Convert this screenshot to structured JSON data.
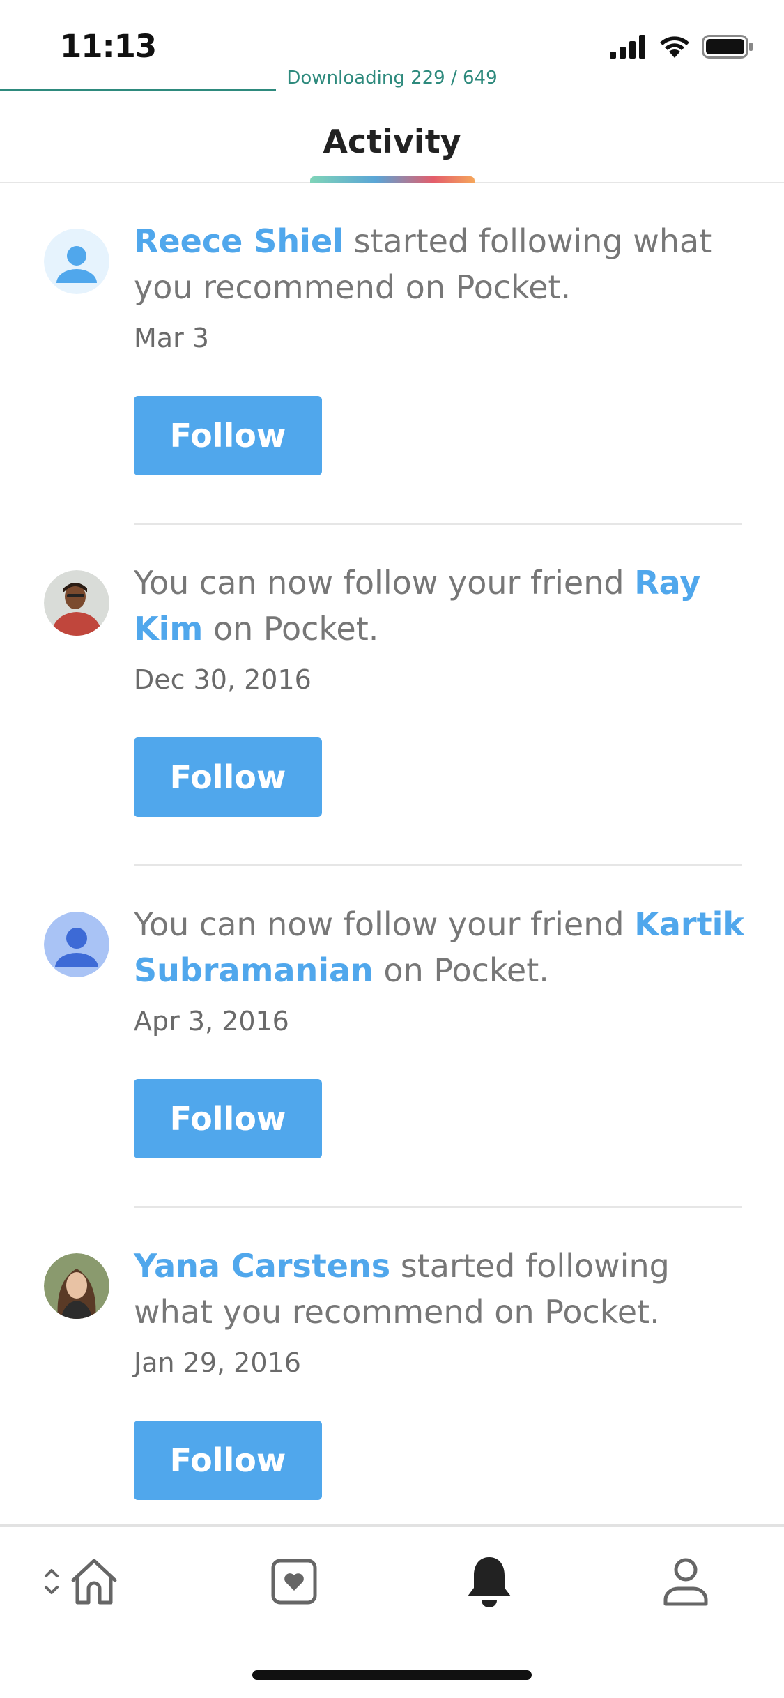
{
  "status_bar": {
    "time": "11:13",
    "icons": [
      "cellular-signal-icon",
      "wifi-icon",
      "battery-icon"
    ]
  },
  "download": {
    "label": "Downloading 229 / 649",
    "color": "#2e8a7d"
  },
  "header": {
    "title": "Activity"
  },
  "accent_color": "#50a7ec",
  "feed": [
    {
      "before": "",
      "name": "Reece Shiel",
      "after": " started following what you recommend on Pocket.",
      "date": "Mar 3",
      "button": "Follow",
      "avatar": "default-avatar-light"
    },
    {
      "before": "You can now follow your friend ",
      "name": "Ray Kim",
      "after": " on Pocket.",
      "date": "Dec 30, 2016",
      "button": "Follow",
      "avatar": "photo-avatar"
    },
    {
      "before": "You can now follow your friend ",
      "name": "Kartik Subramanian",
      "after": " on Pocket.",
      "date": "Apr 3, 2016",
      "button": "Follow",
      "avatar": "default-avatar-blue"
    },
    {
      "before": "",
      "name": "Yana Carstens",
      "after": " started following what you recommend on Pocket.",
      "date": "Jan 29, 2016",
      "button": "Follow",
      "avatar": "photo-avatar"
    }
  ],
  "tab_bar": {
    "tabs": [
      {
        "name": "home",
        "icon": "home-icon",
        "active": false
      },
      {
        "name": "recommendations",
        "icon": "heart-square-icon",
        "active": false
      },
      {
        "name": "activity",
        "icon": "bell-icon",
        "active": true
      },
      {
        "name": "profile",
        "icon": "person-icon",
        "active": false
      }
    ]
  }
}
